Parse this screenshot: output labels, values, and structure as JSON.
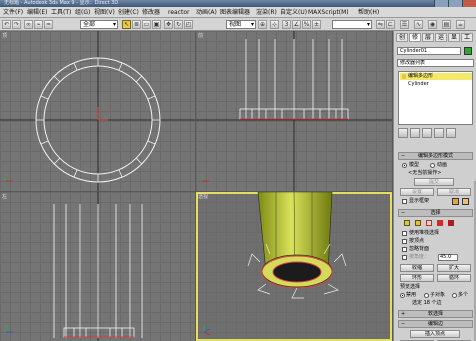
{
  "window": {
    "title": "无标题 - Autodesk 3ds Max 9 - 显示：Direct 3D"
  },
  "menu": [
    "文件(F)",
    "编辑(E)",
    "工具(T)",
    "组(G)",
    "视图(V)",
    "创建(C)",
    "修改器",
    "reactor",
    "动画(A)",
    "图表编辑器",
    "渲染(R)",
    "自定义(U)",
    "MAXScript(M)",
    "帮助(H)"
  ],
  "toolbar": {
    "filter_value": "全部",
    "coord_value": "视图",
    "named_selection": ""
  },
  "viewports": {
    "top_label": "顶",
    "front_label": "前",
    "left_label": "左",
    "perspective_label": "透视"
  },
  "command_panel": {
    "tabs": [
      "创",
      "修",
      "层",
      "运",
      "显",
      "工"
    ],
    "object_name": "Cylinder01",
    "color_swatch": "#2fa72f",
    "modifier_list": "修改器列表",
    "stack": [
      {
        "label": "编辑多边形",
        "selected": true
      },
      {
        "label": "Cylinder",
        "selected": false
      }
    ],
    "edit_mode_header": "编辑多边形模式",
    "model_label": "模型",
    "animate_label": "动画",
    "no_op_label": "<无当前操作>",
    "commit_button": "提交",
    "settings_button": "设置",
    "cancel_button": "取消",
    "show_cage_label": "显示框架",
    "cage_colors": [
      "#e8a438",
      "#f0c070"
    ],
    "selection_header": "选择",
    "by_vertex_label": "使用堆栈选择",
    "by_vertex2_label": "按顶点",
    "ignore_backfacing_label": "忽略背面",
    "by_angle_label": "按角度：",
    "by_angle_value": "45.0",
    "shrink_button": "收缩",
    "grow_button": "扩大",
    "ring_button": "环形",
    "loop_button": "循环",
    "preview_selection_label": "预览选择",
    "preview_off_label": "禁用",
    "preview_subobj_label": "子对象",
    "preview_multi_label": "多个",
    "selected_count": "选定 18 个边",
    "soft_selection_header": "软选择",
    "edit_edges_header": "编辑边",
    "insert_vertex_button": "插入顶点",
    "remove_button": "移除",
    "split_button": "分割"
  }
}
